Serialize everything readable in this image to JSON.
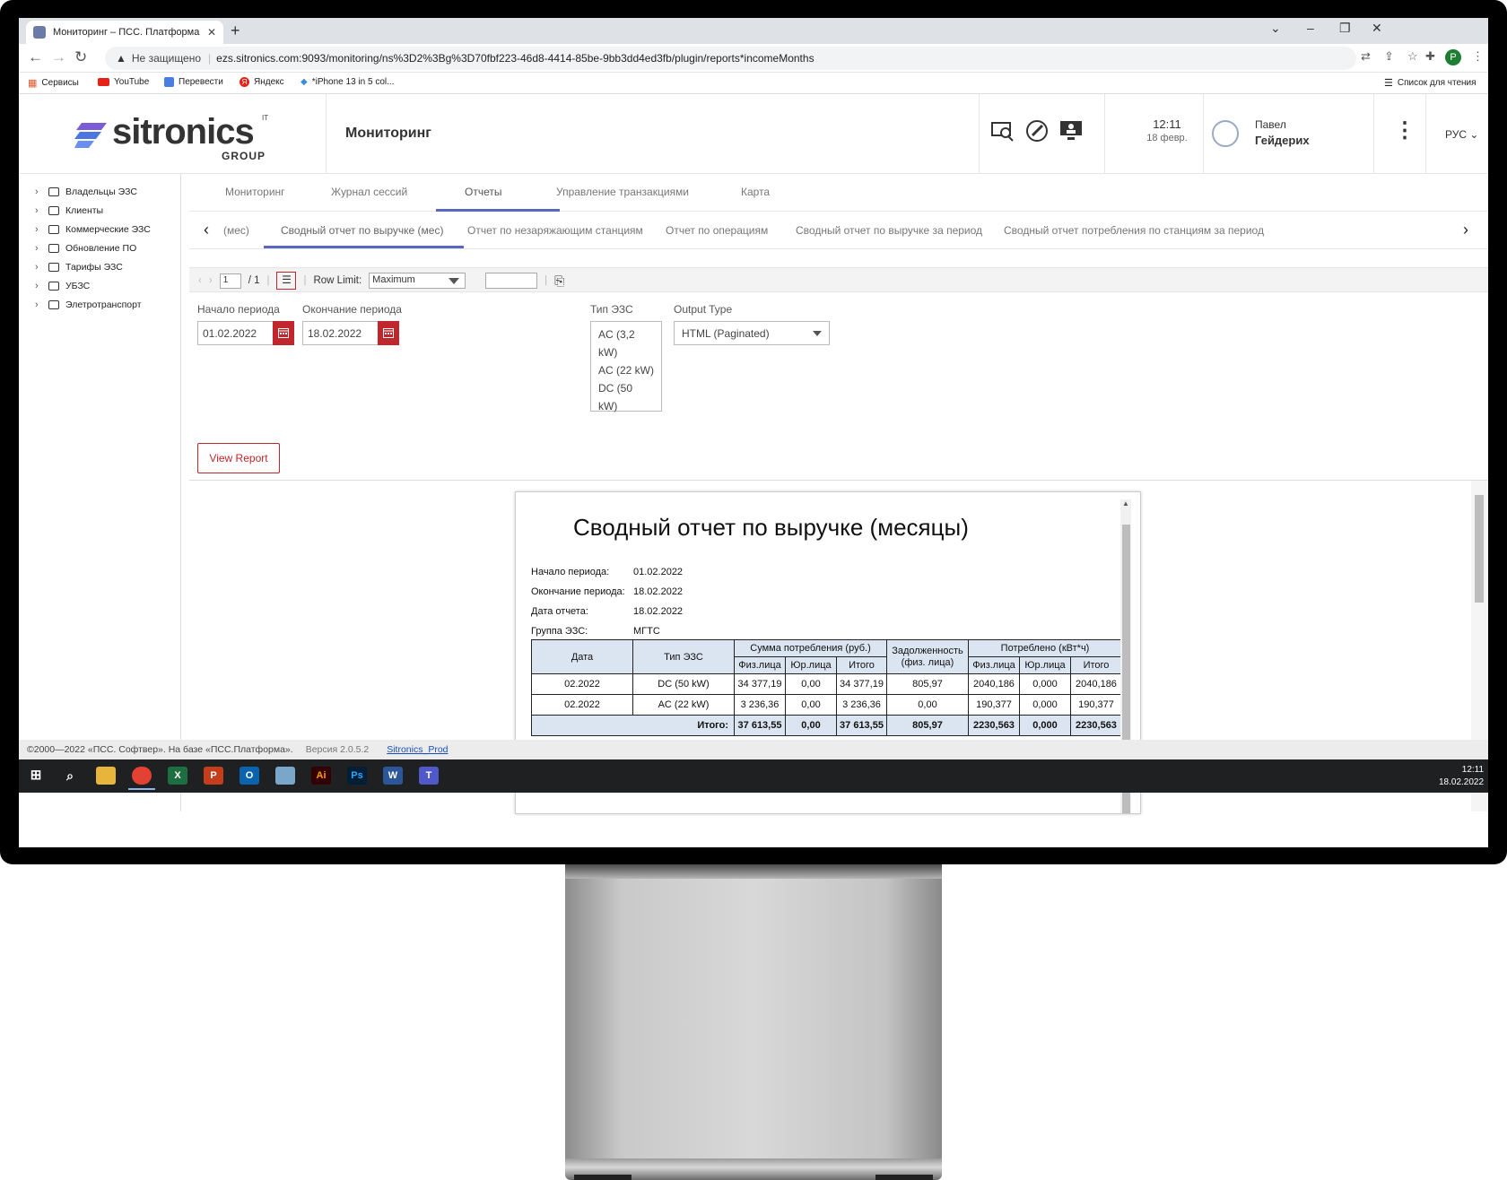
{
  "browser": {
    "tab_title": "Мониторинг – ПСС. Платформа",
    "new_tab": "+",
    "security_label": "Не защищено",
    "url": "ezs.sitronics.com:9093/monitoring/ns%3D2%3Bg%3D70fbf223-46d8-4414-85be-9bb3dd4ed3fb/plugin/reports*incomeMonths",
    "profile_initial": "P",
    "bookmarks": [
      "Сервисы",
      "YouTube",
      "Перевести",
      "Яндекс",
      "*iPhone 13 in 5 col..."
    ],
    "reading_list": "Список для чтения"
  },
  "header": {
    "logo_text": "sitronics",
    "logo_it": "IT",
    "logo_group": "GROUP",
    "title": "Мониторинг",
    "time": "12:11",
    "date": "18 февр.",
    "user_first": "Павел",
    "user_last": "Гейдерих",
    "lang": "РУС"
  },
  "sidebar": {
    "items": [
      "Владельцы ЭЗС",
      "Клиенты",
      "Коммерческие ЭЗС",
      "Обновление ПО",
      "Тарифы ЭЗС",
      "УБЗС",
      "Элетротранспорт"
    ]
  },
  "nav_tabs": [
    "Мониторинг",
    "Журнал сессий",
    "Отчеты",
    "Управление транзакциями",
    "Карта"
  ],
  "report_tabs": [
    "(мес)",
    "Сводный отчет по выручке (мес)",
    "Отчет по незаряжающим станциям",
    "Отчет по операциям",
    "Сводный отчет по выручке за период",
    "Сводный отчет потребления по станциям за период"
  ],
  "toolbar": {
    "page": "1",
    "page_total": "/ 1",
    "row_limit_label": "Row Limit:",
    "row_limit_value": "Maximum"
  },
  "params": {
    "start_label": "Начало периода",
    "start_value": "01.02.2022",
    "end_label": "Окончание периода",
    "end_value": "18.02.2022",
    "type_label": "Тип ЭЗС",
    "type_options": [
      "AC (3,2 kW)",
      "AC (22 kW)",
      "DC (50 kW)"
    ],
    "output_label": "Output Type",
    "output_value": "HTML (Paginated)",
    "view_button": "View Report"
  },
  "report": {
    "title": "Сводный отчет по выручке (месяцы)",
    "meta": [
      {
        "label": "Начало периода:",
        "value": "01.02.2022"
      },
      {
        "label": "Окончание периода:",
        "value": "18.02.2022"
      },
      {
        "label": "Дата отчета:",
        "value": "18.02.2022"
      },
      {
        "label": "Группа ЭЗС:",
        "value": "МГТС"
      }
    ],
    "col_date": "Дата",
    "col_type": "Тип ЭЗС",
    "col_sum": "Сумма потребления (руб.)",
    "col_debt": "Задолженность (физ. лица)",
    "col_consumed": "Потреблено (кВт*ч)",
    "sub_phys": "Физ.лица",
    "sub_jur": "Юр.лица",
    "sub_total": "Итого",
    "rows": [
      [
        "02.2022",
        "DC (50 kW)",
        "34 377,19",
        "0,00",
        "34 377,19",
        "805,97",
        "2040,186",
        "0,000",
        "2040,186"
      ],
      [
        "02.2022",
        "AC (22 kW)",
        "3 236,36",
        "0,00",
        "3 236,36",
        "0,00",
        "190,377",
        "0,000",
        "190,377"
      ]
    ],
    "total_label": "Итого:",
    "totals": [
      "37 613,55",
      "0,00",
      "37 613,55",
      "805,97",
      "2230,563",
      "0,000",
      "2230,563"
    ]
  },
  "footer": {
    "copyright": "©2000—2022 «ПСС. Софтвер». На базе «ПСС.Платформа».",
    "version": "Версия 2.0.5.2",
    "link": "Sitronics_Prod"
  },
  "taskbar": {
    "time": "12:11",
    "date": "18.02.2022"
  }
}
